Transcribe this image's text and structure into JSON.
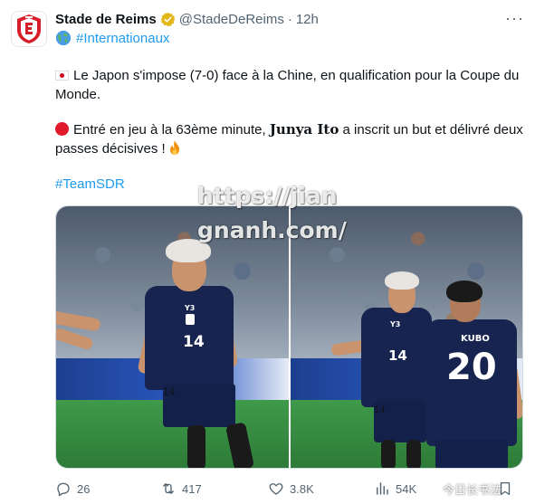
{
  "tweet": {
    "author_name": "Stade de Reims",
    "handle": "@StadeDeReims",
    "separator": "·",
    "time": "12h",
    "more_label": "···",
    "category_hashtag": "#Internationaux",
    "paragraph1": "Le Japon s'impose (7-0) face à la Chine, en qualification pour la Coupe du Monde.",
    "paragraph2_before": "Entré en jeu à la 63ème minute,",
    "paragraph2_name": "Junya Ito",
    "paragraph2_after": "a inscrit un but et délivré deux passes décisives !",
    "team_hashtag": "#TeamSDR"
  },
  "media": {
    "left_player_number": "14",
    "right_player_number": "14",
    "right_teammate_name": "KUBO",
    "right_teammate_number": "20",
    "sponsor_mark": "Y3"
  },
  "overlay": {
    "watermark_text": "https://jiangnanh.com/",
    "corner_watermark": "今日长书法"
  },
  "actions": {
    "replies": "26",
    "retweets": "417",
    "likes": "3.8K",
    "views": "54K"
  },
  "colors": {
    "accent": "#1d9bf0",
    "muted": "#536471",
    "text": "#0f1419",
    "verified_gold": "#e2b719",
    "club_red": "#d71e28",
    "japan_navy": "#17244f"
  },
  "icons": {
    "avatar": "stade-de-reims-crest",
    "verified": "verified-gold-badge-icon",
    "globe": "globe-icon",
    "flag": "japan-flag-icon",
    "red_circle": "red-circle-icon",
    "fire": "fire-icon",
    "reply": "reply-icon",
    "retweet": "retweet-icon",
    "like": "heart-icon",
    "views": "views-bar-chart-icon",
    "bookmark": "bookmark-icon",
    "weibo": "weibo-logo-icon"
  }
}
